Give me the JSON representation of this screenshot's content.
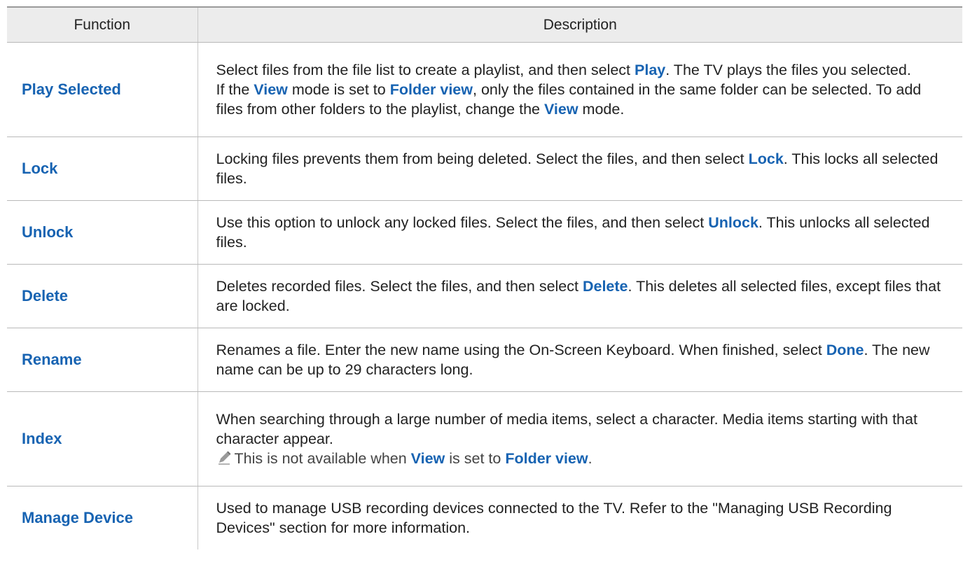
{
  "header": {
    "function": "Function",
    "description": "Description"
  },
  "rows": [
    {
      "name": "Play Selected",
      "lines": [
        [
          "Select files from the file list to create a playlist, and then select ",
          "Play",
          ". The TV plays the files you selected."
        ],
        [
          "If the ",
          "View",
          " mode is set to ",
          "Folder view",
          ", only the files contained in the same folder can be selected. To add files from other folders to the playlist, change the ",
          "View",
          " mode."
        ]
      ]
    },
    {
      "name": "Lock",
      "lines": [
        [
          "Locking files prevents them from being deleted. Select the files, and then select ",
          "Lock",
          ". This locks all selected files."
        ]
      ]
    },
    {
      "name": "Unlock",
      "lines": [
        [
          "Use this option to unlock any locked files. Select the files, and then select ",
          "Unlock",
          ". This unlocks all selected files."
        ]
      ]
    },
    {
      "name": "Delete",
      "lines": [
        [
          "Deletes recorded files. Select the files, and then select ",
          "Delete",
          ". This deletes all selected files, except files that are locked."
        ]
      ]
    },
    {
      "name": "Rename",
      "lines": [
        [
          "Renames a file. Enter the new name using the On-Screen Keyboard. When finished, select ",
          "Done",
          ". The new name can be up to 29 characters long."
        ]
      ]
    },
    {
      "name": "Index",
      "lines": [
        [
          "When searching through a large number of media items, select a character. Media items starting with that character appear."
        ]
      ],
      "note": [
        "This is not available when ",
        "View",
        " is set to ",
        "Folder view",
        "."
      ],
      "note_icon": "pencil-icon"
    },
    {
      "name": "Manage Device",
      "lines": [
        [
          "Used to manage USB recording devices connected to the TV. Refer to the \"Managing USB Recording Devices\" section for more information."
        ]
      ]
    }
  ],
  "colors": {
    "highlight": "#1763b2",
    "header_bg": "#ececec",
    "text": "#222222"
  }
}
